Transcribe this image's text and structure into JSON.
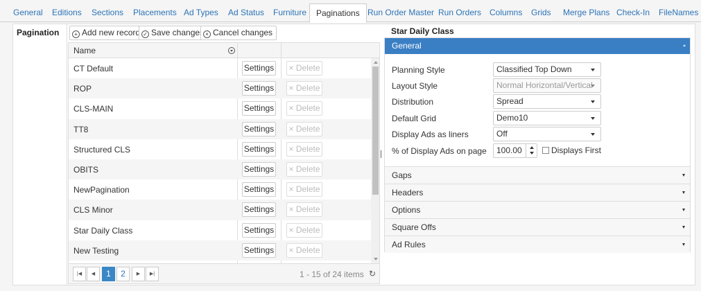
{
  "tabs": [
    {
      "label": "General"
    },
    {
      "label": "Editions"
    },
    {
      "label": "Sections"
    },
    {
      "label": "Placements"
    },
    {
      "label": "Ad Types"
    },
    {
      "label": "Ad Status"
    },
    {
      "label": "Furniture"
    },
    {
      "label": "Paginations",
      "active": true
    },
    {
      "label": "Run Order Master"
    },
    {
      "label": "Run Orders"
    },
    {
      "label": "Columns"
    },
    {
      "label": "Grids"
    },
    {
      "label": "Merge Plans"
    },
    {
      "label": "Check-In"
    },
    {
      "label": "FileNames"
    }
  ],
  "left_label": "Pagination",
  "toolbar": {
    "add": "Add new record",
    "save": "Save changes",
    "cancel": "Cancel changes"
  },
  "grid": {
    "column_name": "Name",
    "settings_label": "Settings",
    "delete_label": "× Delete",
    "rows": [
      "CT Default",
      "ROP",
      "CLS-MAIN",
      "TT8",
      "Structured CLS",
      "OBITS",
      "NewPagination",
      "CLS Minor",
      "Star Daily Class",
      "New Testing"
    ],
    "pager": {
      "pages": [
        "1",
        "2"
      ],
      "current": "1",
      "info": "1 - 15 of 24 items"
    }
  },
  "detail": {
    "title": "Star Daily Class",
    "general_header": "General",
    "fields": {
      "planning_style": {
        "label": "Planning Style",
        "value": "Classified Top Down"
      },
      "layout_style": {
        "label": "Layout Style",
        "value": "Normal Horizontal/Vertical"
      },
      "distribution": {
        "label": "Distribution",
        "value": "Spread"
      },
      "default_grid": {
        "label": "Default Grid",
        "value": "Demo10"
      },
      "display_ads_liners": {
        "label": "Display Ads as liners",
        "value": "Off"
      },
      "percent_display": {
        "label": "% of Display Ads on page",
        "value": "100.00"
      },
      "displays_first": {
        "label": "Displays First",
        "checked": false
      }
    },
    "sections": [
      "Gaps",
      "Headers",
      "Options",
      "Square Offs",
      "Ad Rules"
    ]
  },
  "colors": {
    "accent": "#3a7fc4",
    "link": "#2c74b8"
  }
}
